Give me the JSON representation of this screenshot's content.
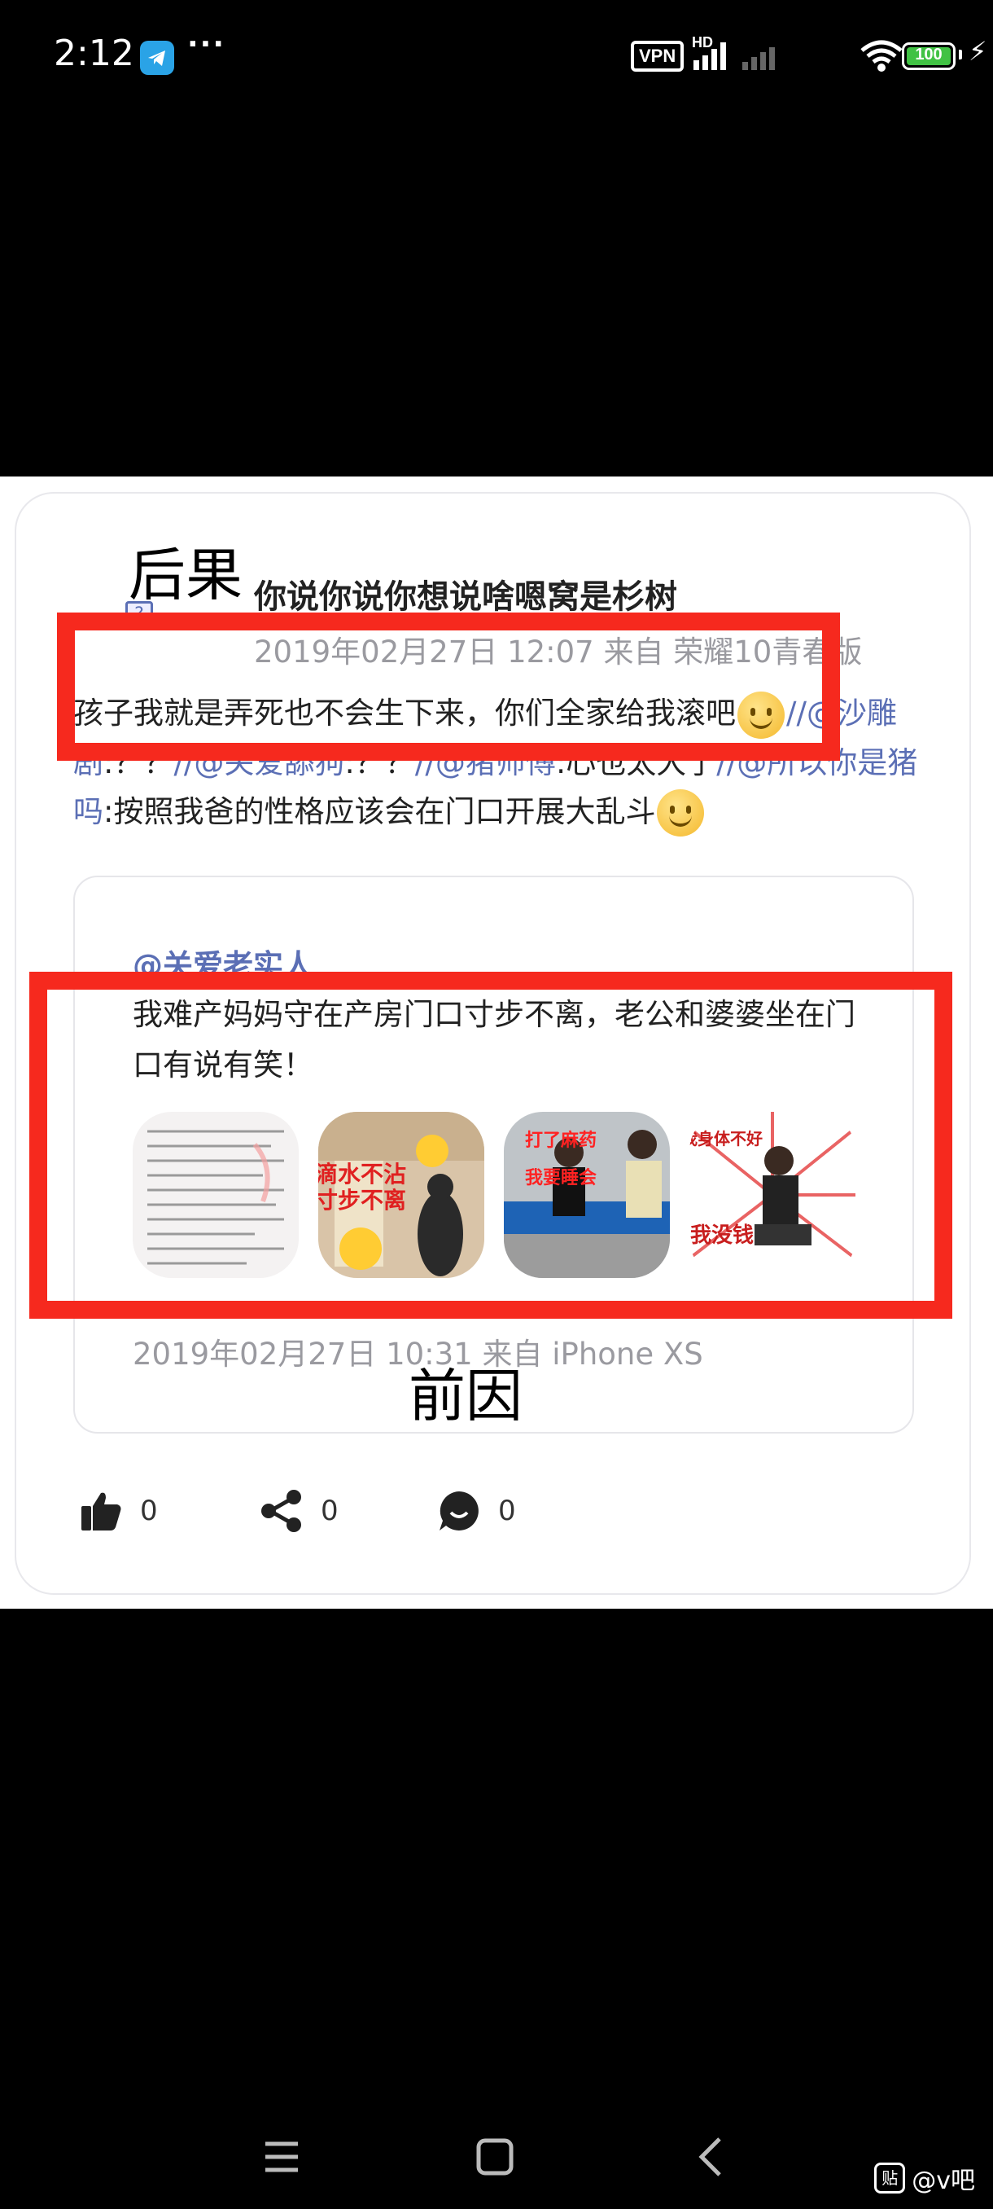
{
  "status_bar": {
    "time": "2:12",
    "more": "···",
    "vpn": "VPN",
    "network": "HD",
    "battery": "100",
    "battery_color": "#41c244"
  },
  "labels": {
    "consequence": "后果",
    "cause": "前因"
  },
  "repost": {
    "author": "你说你说你想说啥嗯窝是杉树",
    "meta": "2019年02月27日 12:07 来自 荣耀10青春版",
    "text_main": "孩子我就是弄死也不会生下来，你们全家给我滚吧",
    "chain": [
      {
        "sep": "//",
        "user": "@沙雕剧",
        "text": ":？？"
      },
      {
        "sep": "//",
        "user": "@关爱舔狗",
        "text": ":？？"
      },
      {
        "sep": "//",
        "user": "@猪师傅",
        "text": ":心也太大了"
      },
      {
        "sep": "//",
        "user": "@所以你是猪吗",
        "text": ":按照我爸的性格应该会在门口开展大乱斗"
      }
    ]
  },
  "original": {
    "author": "@关爱老实人",
    "text": "我难产妈妈守在产房门口寸步不离，老公和婆婆坐在门口有说有笑！",
    "meta": "2019年02月27日 10:31 来自 iPhone XS",
    "thumb_captions": [
      "",
      "滴水不沾 寸步不离",
      "打了麻药 我要睡会",
      "我身体不好 我没钱"
    ]
  },
  "actions": {
    "like_count": "0",
    "share_count": "0",
    "comment_count": "0"
  },
  "watermark": {
    "icon": "贴",
    "text": "@v吧"
  },
  "colors": {
    "red_box": "#f6291e",
    "mention": "#5b6fb5",
    "meta": "#9a9aa0"
  }
}
